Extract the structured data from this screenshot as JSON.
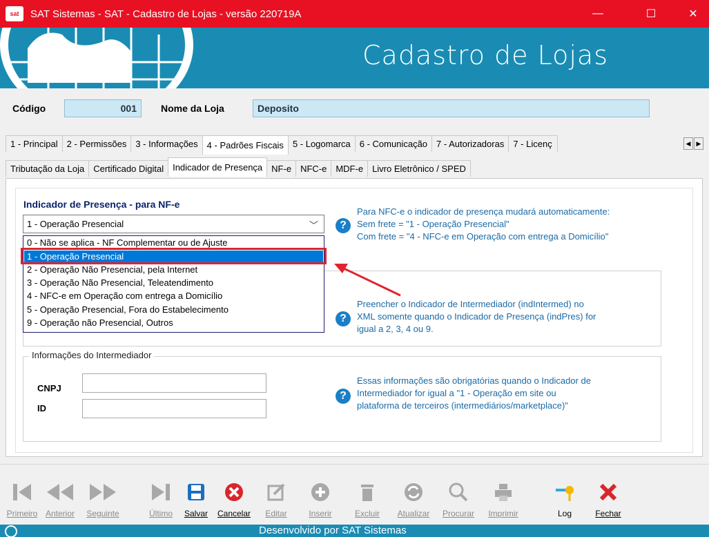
{
  "window": {
    "app_icon_text": "sat",
    "title": "SAT Sistemas - SAT - Cadastro de Lojas - versão 220719A",
    "minimize": "—",
    "maximize": "☐",
    "close": "✕"
  },
  "banner": {
    "title": "Cadastro de Lojas"
  },
  "header": {
    "codigo_label": "Código",
    "codigo_value": "001",
    "nome_label": "Nome da Loja",
    "nome_value": "Deposito"
  },
  "tabs_main": [
    {
      "label": "1 - Principal"
    },
    {
      "label": "2 - Permissões"
    },
    {
      "label": "3 - Informações"
    },
    {
      "label": "4 - Padrões Fiscais",
      "active": true
    },
    {
      "label": "5 - Logomarca"
    },
    {
      "label": "6 - Comunicação"
    },
    {
      "label": "7 - Autorizadoras"
    },
    {
      "label": "7 - Licenç"
    }
  ],
  "tabs_sub": [
    {
      "label": "Tributação da Loja"
    },
    {
      "label": "Certificado Digital"
    },
    {
      "label": "Indicador de Presença",
      "active": true
    },
    {
      "label": "NF-e"
    },
    {
      "label": "NFC-e"
    },
    {
      "label": "MDF-e"
    },
    {
      "label": "Livro Eletrônico / SPED"
    }
  ],
  "presenca": {
    "title": "Indicador de Presença - para NF-e",
    "selected": "1 - Operação Presencial",
    "options": [
      "0 - Não se aplica - NF Complementar ou de Ajuste",
      "1 - Operação Presencial",
      "2 - Operação Não Presencial, pela Internet",
      "3 - Operação Não Presencial, Teleatendimento",
      "4 - NFC-e em Operação com entrega a Domicílio",
      "5 - Operação Presencial, Fora do Estabelecimento",
      "9 - Operação não Presencial, Outros"
    ],
    "highlight_index": 1
  },
  "info": {
    "nfce_line1": "Para NFC-e o indicador de presença mudará automaticamente:",
    "nfce_line2": "Sem frete = \"1 - Operação Presencial\"",
    "nfce_line3": "Com frete = \"4 - NFC-e em Operação com entrega a Domicílio\"",
    "interm_line1": "Preencher o Indicador de Intermediador (indIntermed) no",
    "interm_line2": "XML somente quando o Indicador de Presença (indPres) for",
    "interm_line3": "igual a 2, 3, 4 ou 9.",
    "obrig_line1": "Essas informações são obrigatórias quando o Indicador de",
    "obrig_line2": "Intermediador for igual a \"1 - Operação em site ou",
    "obrig_line3": "plataforma de terceiros (intermediários/marketplace)\""
  },
  "intermediador": {
    "group_title": "Informações do Intermediador",
    "cnpj_label": "CNPJ",
    "cnpj_value": "",
    "id_label": "ID",
    "id_value": ""
  },
  "toolbar": {
    "primeiro": "Primeiro",
    "anterior": "Anterior",
    "seguinte": "Seguinte",
    "ultimo": "Último",
    "salvar": "Salvar",
    "cancelar": "Cancelar",
    "editar": "Editar",
    "inserir": "Inserir",
    "excluir": "Excluir",
    "atualizar": "Atualizar",
    "procurar": "Procurar",
    "imprimir": "Imprimir",
    "log": "Log",
    "fechar": "Fechar"
  },
  "status": {
    "text": "Desenvolvido por SAT Sistemas"
  },
  "colors": {
    "titlebar": "#e81123",
    "banner": "#1a8cb3",
    "info_text": "#1a6aa5",
    "highlight": "#0078d7",
    "annotation": "#e0232f"
  }
}
